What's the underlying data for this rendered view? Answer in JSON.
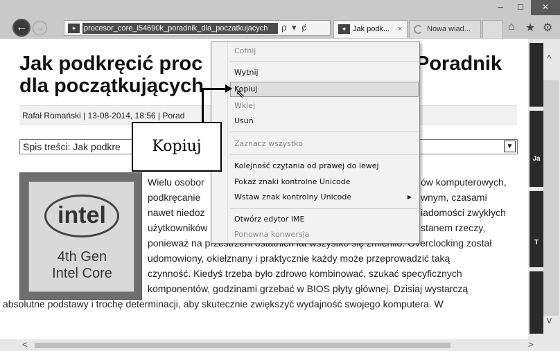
{
  "window": {
    "minimize": "–",
    "maximize": "□",
    "close": "×"
  },
  "toolbar": {
    "back_icon": "arrow-left-icon",
    "back": "←",
    "forward": "→",
    "address": "procesor_core_i54690k_poradnik_dla_poczatkujacych",
    "address_icons": [
      "ρ",
      "▾",
      "ȼ"
    ],
    "tabs": [
      {
        "label": "Jak podk...",
        "close": "×"
      },
      {
        "label": "Nowa wiad..."
      }
    ],
    "home": "⌂",
    "star": "★",
    "gear": "⚙"
  },
  "article": {
    "title_line1": "Jak podkręcić proc",
    "title_line1_right": "Poradnik",
    "title_line2": "dla początkujących",
    "byline": "Rafał Romański | 13-08-2014, 18:56 | Porad",
    "toc": "Spis treści: Jak podkre",
    "toc_arrow": "▼",
    "chip": {
      "logo": "intel",
      "gen": "4th Gen",
      "core": "Intel Core"
    },
    "para_left": [
      "Wielu osobor",
      "podkręcanie",
      "nawet niedoz",
      "użytkowników"
    ],
    "para_right": [
      "ów komputerowych,",
      "wnym, czasami",
      "iadomości zwykłych",
      "stanem rzeczy,"
    ],
    "para_full": [
      "ponieważ na przestrzeni ostatnich lat wszystko się zmieniło. Overclocking został",
      "udomowiony, okiełznany i praktycznie każdy może przeprowadzić taką",
      "czynność. Kiedyś trzeba było zdrowo kombinować, szukać specyficznych",
      "komponentów, godzinami grzebać w BIOS płyty głównej. Dzisiaj wystarczą"
    ],
    "para_wide": "absolutne podstawy i trochę determinacji, aby skutecznie zwiększyć wydajność swojego komputera. W"
  },
  "sidebar": {
    "up": "^",
    "down": "v",
    "ad1": "Ja",
    "ad2": "T"
  },
  "hscroll": {
    "left": "<",
    "right": ">"
  },
  "context_menu": {
    "items": [
      {
        "label": "Cofnij",
        "disabled": true
      },
      {
        "label": "Wytnij",
        "disabled": false
      },
      {
        "label": "Kopiuj",
        "disabled": false,
        "hover": true
      },
      {
        "label": "Wklej",
        "disabled": true
      },
      {
        "label": "Usuń",
        "disabled": false
      },
      {
        "label": "Zaznacz wszystko",
        "disabled": true
      },
      {
        "label": "Kolejność czytania od prawej do lewej",
        "disabled": false
      },
      {
        "label": "Pokaż znaki kontrolne Unicode",
        "disabled": false
      },
      {
        "label": "Wstaw znak kontrolny Unicode",
        "disabled": false,
        "submenu": "▶"
      },
      {
        "label": "Otwórz edytor IME",
        "disabled": false
      },
      {
        "label": "Ponowna konwersja",
        "disabled": true
      }
    ]
  },
  "callout": {
    "label": "Kopiuj"
  }
}
